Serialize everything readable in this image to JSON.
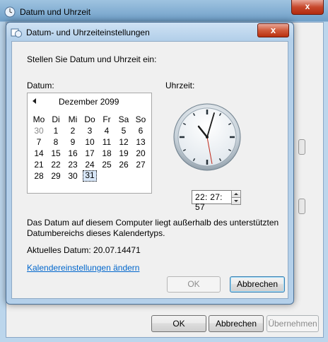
{
  "parent": {
    "title": "Datum und Uhrzeit",
    "close_label": "x",
    "buttons": {
      "ok": "OK",
      "cancel": "Abbrechen",
      "apply": "Übernehmen"
    }
  },
  "dialog": {
    "title": "Datum- und Uhrzeiteinstellungen",
    "close_label": "x",
    "instruction": "Stellen Sie Datum und Uhrzeit ein:",
    "date_label": "Datum:",
    "time_label": "Uhrzeit:",
    "calendar": {
      "month": "Dezember 2099",
      "weekdays": [
        "Mo",
        "Di",
        "Mi",
        "Do",
        "Fr",
        "Sa",
        "So"
      ],
      "weeks": [
        [
          "30",
          "1",
          "2",
          "3",
          "4",
          "5",
          "6"
        ],
        [
          "7",
          "8",
          "9",
          "10",
          "11",
          "12",
          "13"
        ],
        [
          "14",
          "15",
          "16",
          "17",
          "18",
          "19",
          "20"
        ],
        [
          "21",
          "22",
          "23",
          "24",
          "25",
          "26",
          "27"
        ],
        [
          "28",
          "29",
          "30",
          "31",
          "",
          "",
          ""
        ]
      ],
      "selected_day": "31"
    },
    "time_value": "22: 27: 57",
    "warning_line1": "Das Datum auf diesem Computer liegt außerhalb des unterstützten",
    "warning_line2": "Datumbereichs dieses Kalendertyps.",
    "current_date": "Aktuelles Datum: 20.07.14471",
    "calendar_settings_link": "Kalendereinstellungen ändern",
    "buttons": {
      "ok": "OK",
      "cancel": "Abbrechen"
    }
  }
}
